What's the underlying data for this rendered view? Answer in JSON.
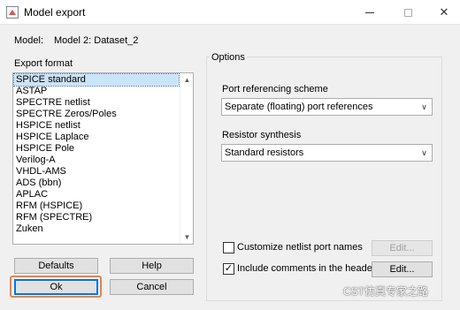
{
  "window": {
    "title": "Model export",
    "controls": [
      "minimize-icon",
      "maximize-icon",
      "close-icon"
    ]
  },
  "model": {
    "label": "Model:",
    "value": "Model 2: Dataset_2"
  },
  "export_format": {
    "label": "Export format",
    "selected": "SPICE standard",
    "items": [
      "SPICE standard",
      "ASTAP",
      "SPECTRE netlist",
      "SPECTRE Zeros/Poles",
      "HSPICE netlist",
      "HSPICE Laplace",
      "HSPICE Pole",
      "Verilog-A",
      "VHDL-AMS",
      "ADS (bbn)",
      "APLAC",
      "RFM (HSPICE)",
      "RFM (SPECTRE)",
      "Zuken"
    ]
  },
  "buttons": {
    "defaults": "Defaults",
    "help": "Help",
    "ok": "Ok",
    "cancel": "Cancel"
  },
  "options": {
    "title": "Options",
    "port_referencing": {
      "label": "Port referencing scheme",
      "value": "Separate (floating) port references"
    },
    "resistor_synthesis": {
      "label": "Resistor synthesis",
      "value": "Standard resistors"
    },
    "customize_names": {
      "label": "Customize netlist port names",
      "checked": false,
      "edit_label": "Edit..."
    },
    "include_comments": {
      "label": "Include comments in the header",
      "checked": true,
      "edit_label": "Edit..."
    }
  },
  "watermark": "CST仿真专家之路",
  "colors": {
    "selection_bg": "#cce4f7",
    "highlight_border": "#e8824a",
    "button_bg": "#e1e1e1",
    "dialog_bg": "#f0f0f0"
  }
}
